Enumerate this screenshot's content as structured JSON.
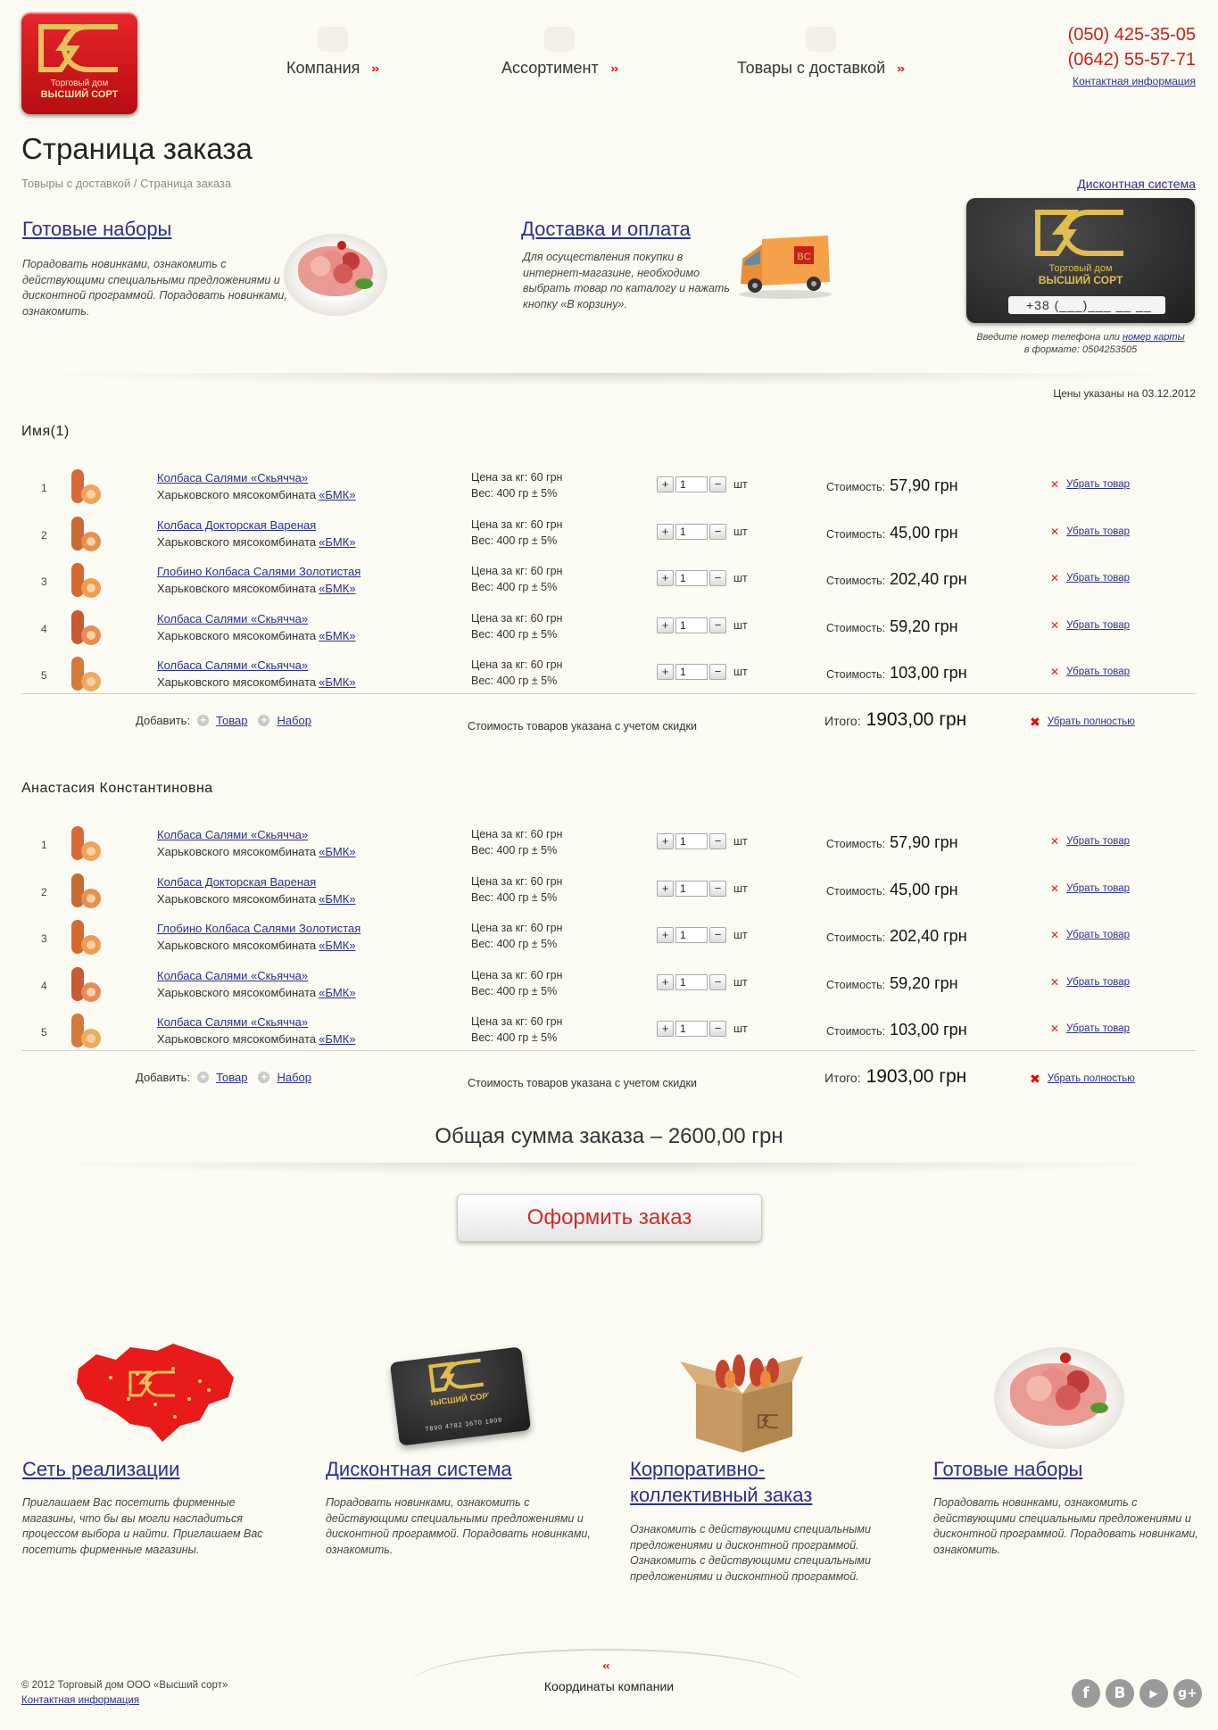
{
  "header": {
    "nav": [
      {
        "label": "Компания"
      },
      {
        "label": "Ассортимент"
      },
      {
        "label": "Товары с доставкой"
      }
    ],
    "phones": [
      "(050) 425-35-05",
      "(0642) 55-57-71"
    ],
    "contact_link": "Контактная информация",
    "logo_text": "Торговый дом ВЫСШИЙ СОРТ"
  },
  "page": {
    "title": "Страница заказа",
    "breadcrumb": "Товыры с доставкой / Страница заказа"
  },
  "promo": {
    "sets": {
      "title": "Готовые наборы",
      "text": "Порадовать новинками, ознакомить с действующими специальными предложениями и дисконтной программой. Порадовать новинками, ознакомить."
    },
    "delivery": {
      "title": "Доставка и оплата",
      "text": "Для осуществления покупки в интернет-магазине, необходимо выбрать товар по каталогу и нажать кнопку «В корзину»."
    }
  },
  "discount": {
    "link": "Дисконтная система",
    "card_logo_text": "Торговый дом ВЫСШИЙ СОРТ",
    "phone_placeholder": "+38 (___)___ __ __",
    "hint_prefix": "Введите номер телефона или",
    "hint_link": "номер карты",
    "hint_suffix": "в формате: 0504253505"
  },
  "prices_date": "Цены указаны на 03.12.2012",
  "groups": [
    {
      "name": "Имя(1)",
      "items": [
        {
          "num": "1",
          "name": "Колбаса Салями «Скьячча»",
          "maker": "Харьковского мясокомбината",
          "maker_link": "«БМК»",
          "price": "Цена за кг: 60 грн",
          "weight": "Вес: 400 гр ± 5%",
          "qty": "1",
          "unit": "шт",
          "cost_label": "Стоимость:",
          "cost": "57,90 грн",
          "remove": "Убрать товар"
        },
        {
          "num": "2",
          "name": "Колбаса Докторская Вареная",
          "maker": "Харьковского мясокомбината",
          "maker_link": "«БМК»",
          "price": "Цена за кг: 60 грн",
          "weight": "Вес: 400 гр ± 5%",
          "qty": "1",
          "unit": "шт",
          "cost_label": "Стоимость:",
          "cost": "45,00 грн",
          "remove": "Убрать товар"
        },
        {
          "num": "3",
          "name": "Глобино Колбаса Салями Золотистая",
          "maker": "Харьковского мясокомбината",
          "maker_link": "«БМК»",
          "price": "Цена за кг: 60 грн",
          "weight": "Вес: 400 гр ± 5%",
          "qty": "1",
          "unit": "шт",
          "cost_label": "Стоимость:",
          "cost": "202,40 грн",
          "remove": "Убрать товар"
        },
        {
          "num": "4",
          "name": "Колбаса Салями «Скьячча»",
          "maker": "Харьковского мясокомбината",
          "maker_link": "«БМК»",
          "price": "Цена за кг: 60 грн",
          "weight": "Вес: 400 гр ± 5%",
          "qty": "1",
          "unit": "шт",
          "cost_label": "Стоимость:",
          "cost": "59,20 грн",
          "remove": "Убрать товар"
        },
        {
          "num": "5",
          "name": "Колбаса Салями «Скьячча»",
          "maker": "Харьковского мясокомбината",
          "maker_link": "«БМК»",
          "price": "Цена за кг: 60 грн",
          "weight": "Вес: 400 гр ± 5%",
          "qty": "1",
          "unit": "шт",
          "cost_label": "Стоимость:",
          "cost": "103,00 грн",
          "remove": "Убрать товар"
        }
      ],
      "add_label": "Добавить:",
      "add_item": "Товар",
      "add_set": "Набор",
      "discount_note": "Стоимость товаров указана с учетом скидки",
      "total_label": "Итого:",
      "total": "1903,00 грн",
      "remove_all": "Убрать полностью"
    },
    {
      "name": "Анастасия Константиновна",
      "items": [
        {
          "num": "1",
          "name": "Колбаса Салями «Скьячча»",
          "maker": "Харьковского мясокомбината",
          "maker_link": "«БМК»",
          "price": "Цена за кг: 60 грн",
          "weight": "Вес: 400 гр ± 5%",
          "qty": "1",
          "unit": "шт",
          "cost_label": "Стоимость:",
          "cost": "57,90 грн",
          "remove": "Убрать товар"
        },
        {
          "num": "2",
          "name": "Колбаса Докторская Вареная",
          "maker": "Харьковского мясокомбината",
          "maker_link": "«БМК»",
          "price": "Цена за кг: 60 грн",
          "weight": "Вес: 400 гр ± 5%",
          "qty": "1",
          "unit": "шт",
          "cost_label": "Стоимость:",
          "cost": "45,00 грн",
          "remove": "Убрать товар"
        },
        {
          "num": "3",
          "name": "Глобино Колбаса Салями Золотистая",
          "maker": "Харьковского мясокомбината",
          "maker_link": "«БМК»",
          "price": "Цена за кг: 60 грн",
          "weight": "Вес: 400 гр ± 5%",
          "qty": "1",
          "unit": "шт",
          "cost_label": "Стоимость:",
          "cost": "202,40 грн",
          "remove": "Убрать товар"
        },
        {
          "num": "4",
          "name": "Колбаса Салями «Скьячча»",
          "maker": "Харьковского мясокомбината",
          "maker_link": "«БМК»",
          "price": "Цена за кг: 60 грн",
          "weight": "Вес: 400 гр ± 5%",
          "qty": "1",
          "unit": "шт",
          "cost_label": "Стоимость:",
          "cost": "59,20 грн",
          "remove": "Убрать товар"
        },
        {
          "num": "5",
          "name": "Колбаса Салями «Скьячча»",
          "maker": "Харьковского мясокомбината",
          "maker_link": "«БМК»",
          "price": "Цена за кг: 60 грн",
          "weight": "Вес: 400 гр ± 5%",
          "qty": "1",
          "unit": "шт",
          "cost_label": "Стоимость:",
          "cost": "103,00 грн",
          "remove": "Убрать товар"
        }
      ],
      "add_label": "Добавить:",
      "add_item": "Товар",
      "add_set": "Набор",
      "discount_note": "Стоимость товаров указана с учетом скидки",
      "total_label": "Итого:",
      "total": "1903,00 грн",
      "remove_all": "Убрать полностью"
    }
  ],
  "order_total": "Общая сумма заказа – 2600,00 грн",
  "order_button": "Оформить заказ",
  "features": [
    {
      "title": "Сеть реализации",
      "text": "Приглашаем Вас посетить фирменные магазины, что бы вы могли насладиться процессом выбора и найти. Приглашаем Вас посетить фирменные магазины."
    },
    {
      "title": "Дисконтная система",
      "text": "Порадовать новинками, ознакомить с действующими специальными предложениями и дисконтной программой. Порадовать новинками, ознакомить."
    },
    {
      "title": "Корпоративно-коллективный заказ",
      "text": "Ознакомить с действующими специальными предложениями и дисконтной программой. Ознакомить с действующими специальными предложениями и дисконтной программой."
    },
    {
      "title": "Готовые наборы",
      "text": "Порадовать новинками, ознакомить с действующими специальными предложениями и дисконтной программой. Порадовать новинками, ознакомить."
    }
  ],
  "footer": {
    "copyright": "© 2012 Торговый дом ООО «Высший сорт»",
    "contact_link": "Контактная информация",
    "coords": "Координаты компании",
    "card_number": "7890 4782 3670 1909",
    "social": [
      {
        "icon": "facebook-icon",
        "glyph": "f"
      },
      {
        "icon": "vk-icon",
        "glyph": "B"
      },
      {
        "icon": "youtube-icon",
        "glyph": "▶"
      },
      {
        "icon": "google-plus-icon",
        "glyph": "g+"
      }
    ]
  },
  "colors": {
    "accent_red": "#c8201d",
    "link_blue": "#2b2f8f",
    "gold": "#d8b84a"
  }
}
